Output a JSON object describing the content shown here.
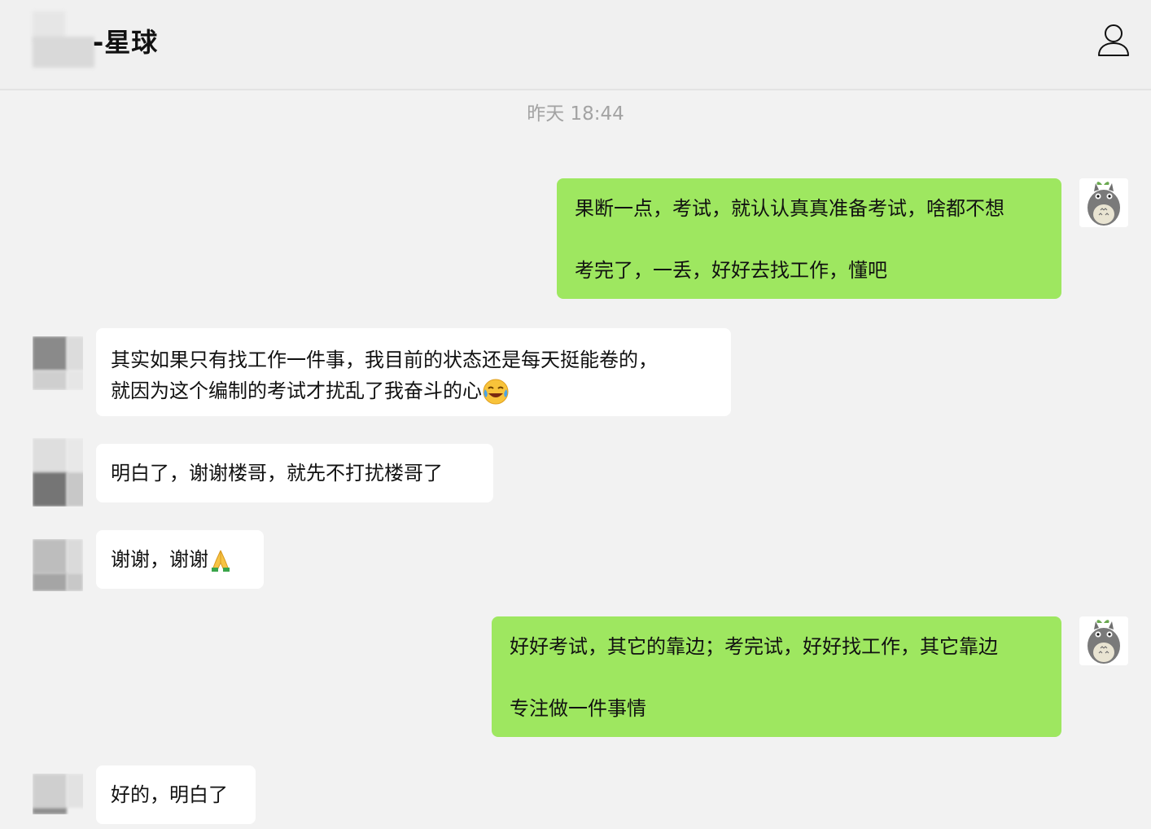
{
  "header": {
    "title": "-星球",
    "profile_icon": "person-icon"
  },
  "timestamp": "昨天 18:44",
  "messages": [
    {
      "direction": "out",
      "lines": [
        "果断一点，考试，就认认真真准备考试，啥都不想",
        "考完了，一丢，好好去找工作，懂吧"
      ]
    },
    {
      "direction": "in",
      "lines": [
        "其实如果只有找工作一件事，我目前的状态还是每天挺能卷的，",
        "就因为这个编制的考试才扰乱了我奋斗的心"
      ],
      "emoji": "crying-laughing-emoji"
    },
    {
      "direction": "in",
      "lines": [
        "明白了，谢谢楼哥，就先不打扰楼哥了"
      ]
    },
    {
      "direction": "in",
      "lines": [
        "谢谢，谢谢"
      ],
      "emoji": "folded-hands-emoji"
    },
    {
      "direction": "out",
      "lines": [
        "好好考试，其它的靠边；考完试，好好找工作，其它靠边",
        "专注做一件事情"
      ]
    },
    {
      "direction": "in",
      "lines": [
        "好的，明白了"
      ]
    }
  ],
  "colors": {
    "background": "#f2f2f2",
    "outgoing_bubble": "#9ee760",
    "incoming_bubble": "#ffffff",
    "timestamp": "#a3a3a3"
  }
}
